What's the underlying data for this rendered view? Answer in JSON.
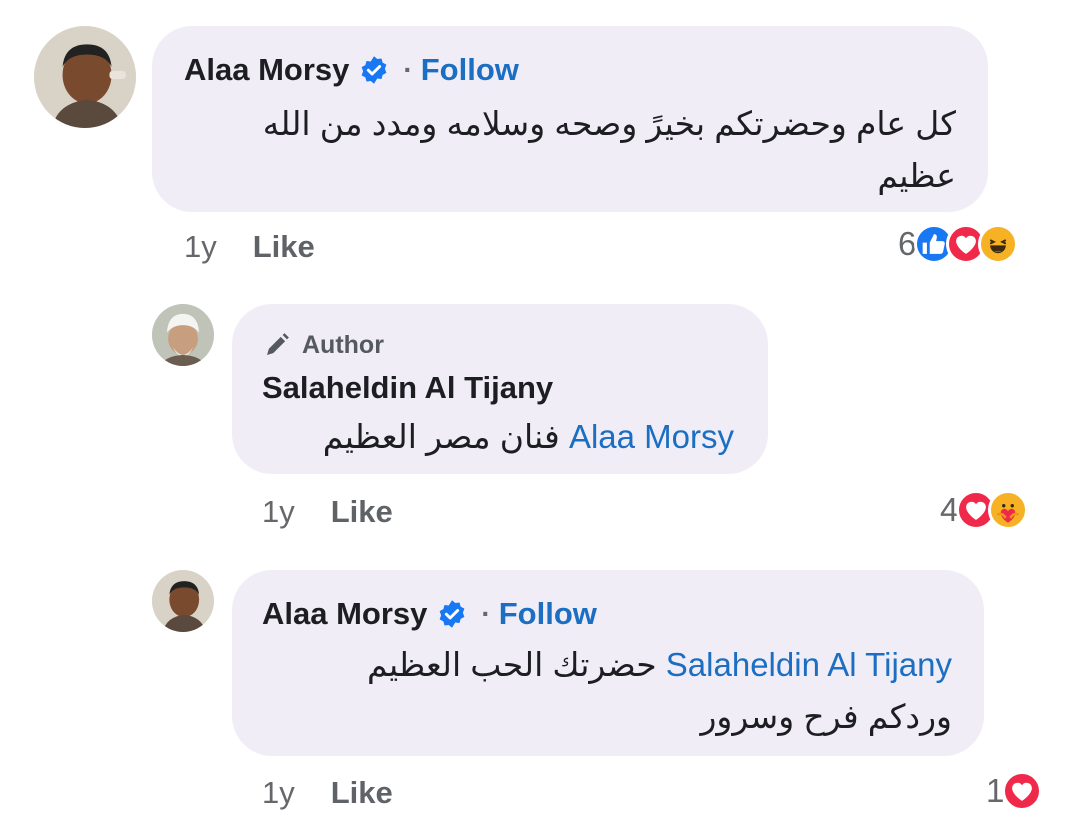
{
  "comments": [
    {
      "author": "Alaa Morsy",
      "verified": true,
      "follow_label": "Follow",
      "separator": "·",
      "text_line1": "كل عام وحضرتكم بخيرً وصحه وسلامه ومدد من الله",
      "text_line2": "عظيم",
      "time": "1y",
      "like_label": "Like",
      "reaction_count": "6",
      "reactions": [
        "like-icon",
        "love-icon",
        "haha-icon"
      ]
    },
    {
      "badge": "Author",
      "author": "Salaheldin Al Tijany",
      "mention": "Alaa Morsy",
      "text_after_mention": "فنان مصر العظيم",
      "time": "1y",
      "like_label": "Like",
      "reaction_count": "4",
      "reactions": [
        "love-icon",
        "care-icon"
      ]
    },
    {
      "author": "Alaa Morsy",
      "verified": true,
      "follow_label": "Follow",
      "separator": "·",
      "mention": "Salaheldin Al Tijany",
      "text_after_mention": "حضرتك الحب العظيم",
      "text_line2": "وردكم فرح وسرور",
      "time": "1y",
      "like_label": "Like",
      "reaction_count": "1",
      "reactions": [
        "love-icon"
      ]
    }
  ],
  "colors": {
    "bubble": "#f0edf6",
    "link": "#1b6ec2",
    "like": "#1877f2",
    "love": "#f0284a",
    "haha": "#f7b125"
  }
}
